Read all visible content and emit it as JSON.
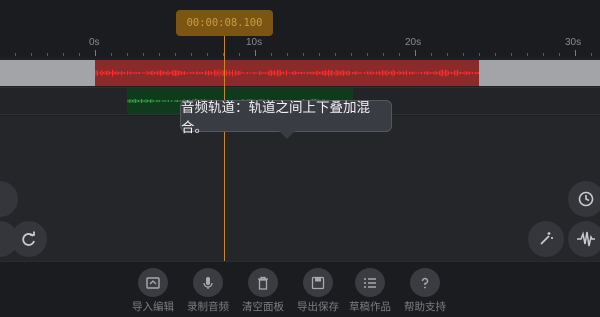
{
  "timeline": {
    "current_time": "00:00:08.100",
    "ruler_labels": [
      "0s",
      "10s",
      "20s",
      "30s"
    ]
  },
  "tooltip": {
    "text": "音频轨道：轨道之间上下叠加混合。"
  },
  "tracks": {
    "audio_clip_color": "#ff2b2b",
    "secondary_clip_color": "#2fa84a"
  },
  "toolbar": {
    "items": [
      {
        "label": "导入编辑",
        "icon": "import-icon"
      },
      {
        "label": "录制音频",
        "icon": "microphone-icon"
      },
      {
        "label": "清空面板",
        "icon": "trash-icon"
      },
      {
        "label": "导出保存",
        "icon": "save-icon"
      },
      {
        "label": "草稿作品",
        "icon": "list-icon"
      },
      {
        "label": "帮助支持",
        "icon": "help-icon"
      }
    ]
  },
  "colors": {
    "accent": "#c8871f",
    "background": "#1f2023",
    "tooltip_bg": "#3a3c43"
  }
}
